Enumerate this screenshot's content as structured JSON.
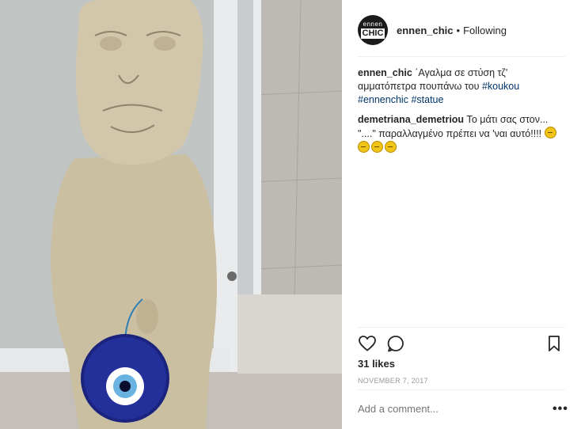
{
  "header": {
    "avatar_line1": "ennen",
    "avatar_line2": "CHIC",
    "username": "ennen_chic",
    "separator": "•",
    "follow_status": "Following"
  },
  "caption": {
    "username": "ennen_chic",
    "text": " ΄Αγαλμα σε στύση τζ' αμματόπετρα πουπάνω του ",
    "tag1": "#koukou",
    "tag2": "#ennenchic",
    "tag3": "#statue"
  },
  "comment": {
    "username": "demetriana_demetriou",
    "text": " Το μάτι σας στον... \"....\" παραλλαγμένο πρέπει να 'ναι αυτό!!!! "
  },
  "likes": "31 likes",
  "date": "NOVEMBER 7, 2017",
  "add_comment_placeholder": "Add a comment...",
  "more_label": "•••",
  "icons": {
    "like": "heart-icon",
    "comment": "comment-icon",
    "save": "bookmark-icon",
    "emoji": "grinning-face-emoji"
  },
  "colors": {
    "hashtag": "#003569",
    "eye_bead_blue": "#1a237e"
  }
}
